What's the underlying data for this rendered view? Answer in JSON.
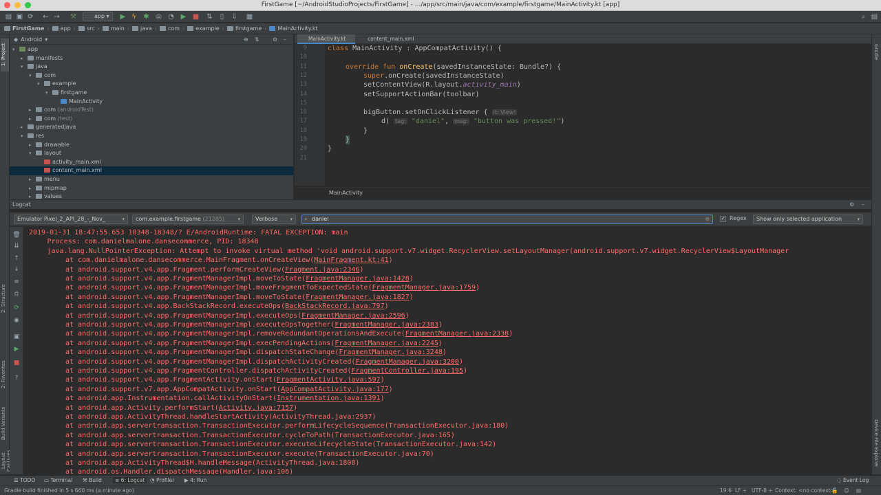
{
  "window": {
    "title": "FirstGame [~/AndroidStudioProjects/FirstGame] - .../app/src/main/java/com/example/firstgame/MainActivity.kt [app]"
  },
  "toolbar": {
    "module": "app"
  },
  "breadcrumb": [
    "FirstGame",
    "app",
    "src",
    "main",
    "java",
    "com",
    "example",
    "firstgame",
    "MainActivity.kt"
  ],
  "project_panel": {
    "view": "Android",
    "tree": [
      {
        "label": "app",
        "extra": "",
        "depth": 0,
        "arrow": "▾",
        "color": "#6a8759"
      },
      {
        "label": "manifests",
        "extra": "",
        "depth": 1,
        "arrow": "▸",
        "color": "#87939a"
      },
      {
        "label": "java",
        "extra": "",
        "depth": 1,
        "arrow": "▾",
        "color": "#87939a"
      },
      {
        "label": "com",
        "extra": "",
        "depth": 2,
        "arrow": "▾",
        "color": "#87939a"
      },
      {
        "label": "example",
        "extra": "",
        "depth": 3,
        "arrow": "▾",
        "color": "#87939a"
      },
      {
        "label": "firstgame",
        "extra": "",
        "depth": 4,
        "arrow": "▾",
        "color": "#87939a"
      },
      {
        "label": "MainActivity",
        "extra": "",
        "depth": 5,
        "arrow": "",
        "color": "#4a88c7"
      },
      {
        "label": "com",
        "extra": "(androidTest)",
        "depth": 2,
        "arrow": "▸",
        "color": "#87939a"
      },
      {
        "label": "com",
        "extra": "(test)",
        "depth": 2,
        "arrow": "▸",
        "color": "#87939a"
      },
      {
        "label": "generatedJava",
        "extra": "",
        "depth": 1,
        "arrow": "▸",
        "color": "#87939a"
      },
      {
        "label": "res",
        "extra": "",
        "depth": 1,
        "arrow": "▾",
        "color": "#87939a"
      },
      {
        "label": "drawable",
        "extra": "",
        "depth": 2,
        "arrow": "▸",
        "color": "#87939a"
      },
      {
        "label": "layout",
        "extra": "",
        "depth": 2,
        "arrow": "▾",
        "color": "#87939a"
      },
      {
        "label": "activity_main.xml",
        "extra": "",
        "depth": 3,
        "arrow": "",
        "color": "#c75450"
      },
      {
        "label": "content_main.xml",
        "extra": "",
        "depth": 3,
        "arrow": "",
        "color": "#c75450"
      },
      {
        "label": "menu",
        "extra": "",
        "depth": 2,
        "arrow": "▸",
        "color": "#87939a"
      },
      {
        "label": "mipmap",
        "extra": "",
        "depth": 2,
        "arrow": "▸",
        "color": "#87939a"
      },
      {
        "label": "values",
        "extra": "",
        "depth": 2,
        "arrow": "▸",
        "color": "#87939a"
      }
    ],
    "selected_index": 14
  },
  "editor": {
    "tabs": [
      "MainActivity.kt",
      "content_main.xml"
    ],
    "active_tab": 0,
    "line_numbers": [
      "9",
      "10",
      "11",
      "12",
      "13",
      "14",
      "15",
      "16",
      "17",
      "18",
      "19",
      "20",
      "21"
    ],
    "code": {
      "l9": [
        "class",
        " MainActivity : AppCompatActivity() {"
      ],
      "l11": [
        "override fun ",
        "onCreate",
        "(savedInstanceState: Bundle?) {"
      ],
      "l12": [
        "super",
        ".onCreate(savedInstanceState)"
      ],
      "l13": [
        "setContentView(R.layout.",
        "activity_main",
        ")"
      ],
      "l14": "setSupportActionBar(toolbar)",
      "l16": [
        "bigButton.setOnClickListener {",
        "it: View!"
      ],
      "l17": [
        "d(",
        "tag:",
        "\"daniel\"",
        ",",
        "msg:",
        "\"button was pressed!\"",
        ")"
      ],
      "l18": "}",
      "l19": "}",
      "l20": "}"
    },
    "crumb": "MainActivity"
  },
  "logcat": {
    "title": "Logcat",
    "device": "Emulator Pixel_2_API_28_-_Nov_",
    "process": "com.example.firstgame",
    "process_pid": "(21285)",
    "level": "Verbose",
    "search": "daniel",
    "regex_label": "Regex",
    "filter": "Show only selected application",
    "lines": [
      {
        "indent": 0,
        "pre": "2019-01-31 18:47:55.653 18348-18348/? E/AndroidRuntime: FATAL EXCEPTION: main",
        "link": "",
        "post": ""
      },
      {
        "indent": 1,
        "pre": "Process: com.danielmalone.dansecommerce, PID: 18348",
        "link": "",
        "post": ""
      },
      {
        "indent": 1,
        "pre": "java.lang.NullPointerException: Attempt to invoke virtual method 'void android.support.v7.widget.RecyclerView.setLayoutManager(android.support.v7.widget.RecyclerView$LayoutManager",
        "link": "",
        "post": ""
      },
      {
        "indent": 2,
        "pre": "at com.danielmalone.dansecommerce.MainFragment.onCreateView(",
        "link": "MainFragment.kt:41",
        "post": ")"
      },
      {
        "indent": 2,
        "pre": "at android.support.v4.app.Fragment.performCreateView(",
        "link": "Fragment.java:2346",
        "post": ")"
      },
      {
        "indent": 2,
        "pre": "at android.support.v4.app.FragmentManagerImpl.moveToState(",
        "link": "FragmentManager.java:1428",
        "post": ")"
      },
      {
        "indent": 2,
        "pre": "at android.support.v4.app.FragmentManagerImpl.moveFragmentToExpectedState(",
        "link": "FragmentManager.java:1759",
        "post": ")"
      },
      {
        "indent": 2,
        "pre": "at android.support.v4.app.FragmentManagerImpl.moveToState(",
        "link": "FragmentManager.java:1827",
        "post": ")"
      },
      {
        "indent": 2,
        "pre": "at android.support.v4.app.BackStackRecord.executeOps(",
        "link": "BackStackRecord.java:797",
        "post": ")"
      },
      {
        "indent": 2,
        "pre": "at android.support.v4.app.FragmentManagerImpl.executeOps(",
        "link": "FragmentManager.java:2596",
        "post": ")"
      },
      {
        "indent": 2,
        "pre": "at android.support.v4.app.FragmentManagerImpl.executeOpsTogether(",
        "link": "FragmentManager.java:2383",
        "post": ")"
      },
      {
        "indent": 2,
        "pre": "at android.support.v4.app.FragmentManagerImpl.removeRedundantOperationsAndExecute(",
        "link": "FragmentManager.java:2338",
        "post": ")"
      },
      {
        "indent": 2,
        "pre": "at android.support.v4.app.FragmentManagerImpl.execPendingActions(",
        "link": "FragmentManager.java:2245",
        "post": ")"
      },
      {
        "indent": 2,
        "pre": "at android.support.v4.app.FragmentManagerImpl.dispatchStateChange(",
        "link": "FragmentManager.java:3248",
        "post": ")"
      },
      {
        "indent": 2,
        "pre": "at android.support.v4.app.FragmentManagerImpl.dispatchActivityCreated(",
        "link": "FragmentManager.java:3200",
        "post": ")"
      },
      {
        "indent": 2,
        "pre": "at android.support.v4.app.FragmentController.dispatchActivityCreated(",
        "link": "FragmentController.java:195",
        "post": ")"
      },
      {
        "indent": 2,
        "pre": "at android.support.v4.app.FragmentActivity.onStart(",
        "link": "FragmentActivity.java:597",
        "post": ")"
      },
      {
        "indent": 2,
        "pre": "at android.support.v7.app.AppCompatActivity.onStart(",
        "link": "AppCompatActivity.java:177",
        "post": ")"
      },
      {
        "indent": 2,
        "pre": "at android.app.Instrumentation.callActivityOnStart(",
        "link": "Instrumentation.java:1391",
        "post": ")"
      },
      {
        "indent": 2,
        "pre": "at android.app.Activity.performStart(",
        "link": "Activity.java:7157",
        "post": ")"
      },
      {
        "indent": 2,
        "pre": "at android.app.ActivityThread.handleStartActivity(ActivityThread.java:2937)",
        "link": "",
        "post": ""
      },
      {
        "indent": 2,
        "pre": "at android.app.servertransaction.TransactionExecutor.performLifecycleSequence(TransactionExecutor.java:180)",
        "link": "",
        "post": ""
      },
      {
        "indent": 2,
        "pre": "at android.app.servertransaction.TransactionExecutor.cycleToPath(TransactionExecutor.java:165)",
        "link": "",
        "post": ""
      },
      {
        "indent": 2,
        "pre": "at android.app.servertransaction.TransactionExecutor.executeLifecycleState(TransactionExecutor.java:142)",
        "link": "",
        "post": ""
      },
      {
        "indent": 2,
        "pre": "at android.app.servertransaction.TransactionExecutor.execute(TransactionExecutor.java:70)",
        "link": "",
        "post": ""
      },
      {
        "indent": 2,
        "pre": "at android.app.ActivityThread$H.handleMessage(ActivityThread.java:1808)",
        "link": "",
        "post": ""
      },
      {
        "indent": 2,
        "pre": "at android.os.Handler.dispatchMessage(",
        "link": "Handler.java:106",
        "post": ")"
      }
    ]
  },
  "side_tabs": {
    "left": [
      "1: Project",
      "2: Structure",
      "2: Favorites",
      "Build Variants",
      "Layout Captures"
    ],
    "right": [
      "Gradle",
      "Device File Explorer"
    ]
  },
  "bottom_tabs": [
    "TODO",
    "Terminal",
    "Build",
    "6: Logcat",
    "Profiler",
    "4: Run"
  ],
  "event_log": "Event Log",
  "status": {
    "message": "Gradle build finished in 5 s 660 ms (a minute ago)",
    "position": "19:6",
    "line_sep": "LF ÷",
    "encoding": "UTF-8 ÷",
    "context": "Context: <no context>"
  },
  "colors": {
    "error_text": "#ff6b68",
    "selection": "#0d293e",
    "accent": "#4a88c7"
  }
}
